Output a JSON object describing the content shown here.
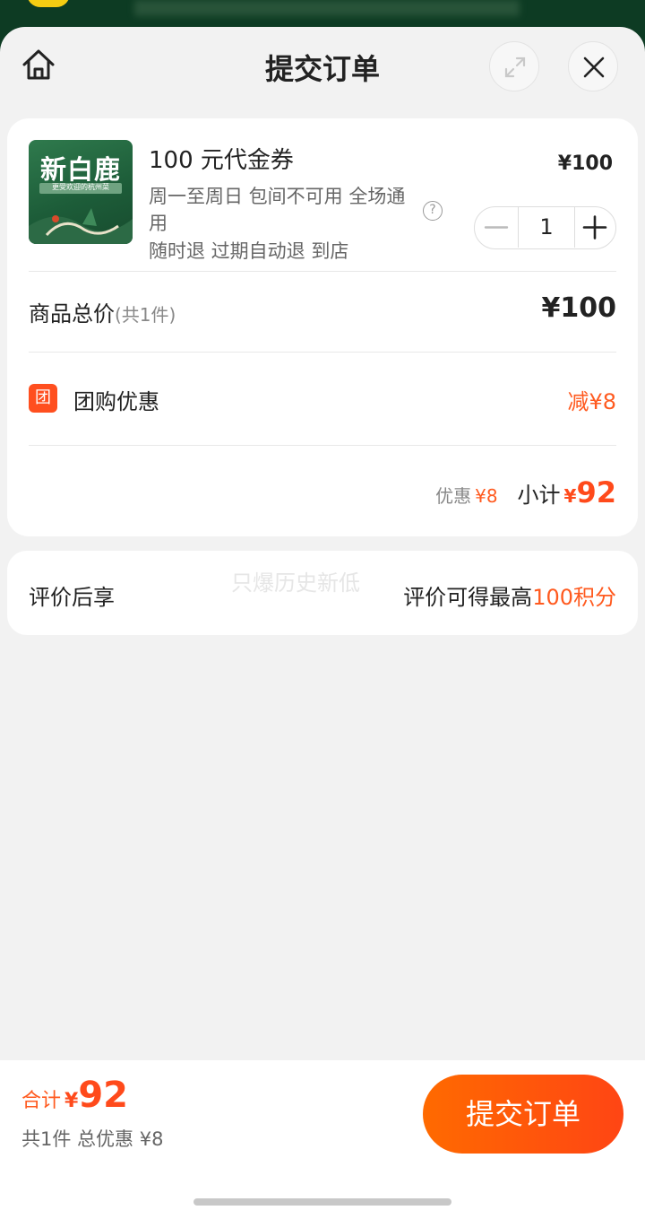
{
  "header": {
    "title": "提交订单",
    "home_icon": "home-icon",
    "expand_icon": "expand-icon",
    "close_icon": "close-icon"
  },
  "product": {
    "thumbnail_brand": "新白鹿",
    "thumbnail_tagline": "更受欢迎的杭州菜",
    "name": "100 元代金券",
    "description": "周一至周日 包间不可用 全场通用",
    "note": "随时退 过期自动退 到店",
    "price": "¥100",
    "quantity": "1",
    "help_icon": "?"
  },
  "summary": {
    "total_label": "商品总价",
    "total_count": "(共1件)",
    "total_value": "¥100",
    "group_icon_text": "团",
    "group_label": "团购优惠",
    "group_value": "减¥8",
    "discount_label": "优惠",
    "discount_value": "¥8",
    "subtotal_label": "小计",
    "subtotal_currency": "¥",
    "subtotal_value": "92"
  },
  "review": {
    "label": "评价后享",
    "watermark": "只爆历史新低",
    "info_prefix": "评价可得最高",
    "info_highlight": "100积分"
  },
  "bottom": {
    "sum_label": "合计",
    "sum_currency": "¥",
    "sum_value": "92",
    "detail": "共1件 总优惠 ¥8",
    "submit_label": "提交订单"
  },
  "colors": {
    "accent": "#ff5a1f",
    "button_gradient_start": "#ff6a00",
    "button_gradient_end": "#ff4514"
  }
}
